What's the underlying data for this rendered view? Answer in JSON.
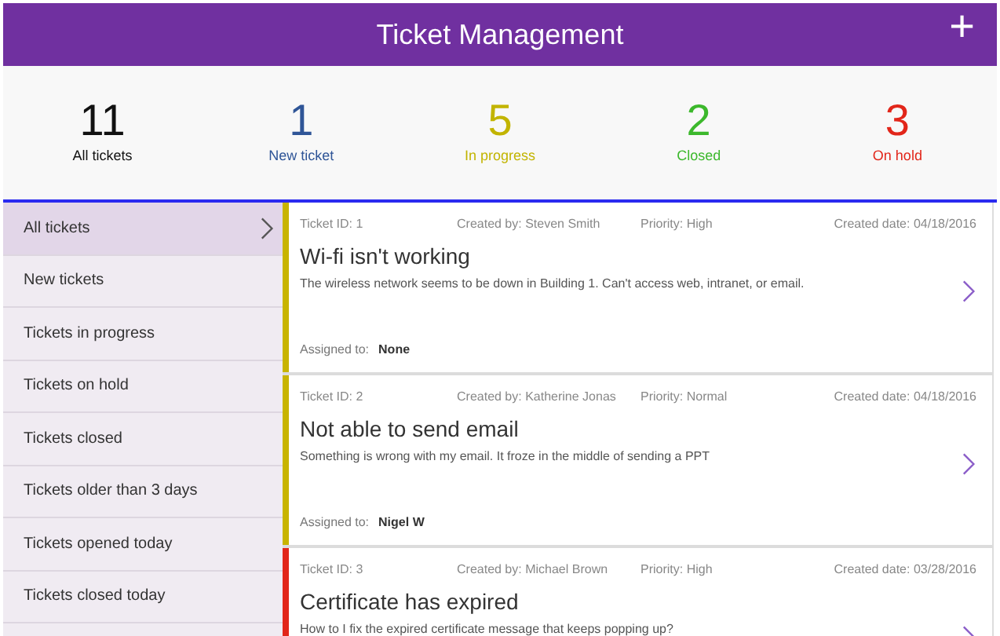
{
  "header": {
    "title": "Ticket Management",
    "add_button": "+"
  },
  "stats": [
    {
      "count": "11",
      "label": "All tickets",
      "color": "#111111"
    },
    {
      "count": "1",
      "label": "New ticket",
      "color": "#2f5597"
    },
    {
      "count": "5",
      "label": "In progress",
      "color": "#c2b400"
    },
    {
      "count": "2",
      "label": "Closed",
      "color": "#3cb82c"
    },
    {
      "count": "3",
      "label": "On hold",
      "color": "#e2261a"
    }
  ],
  "sidebar": {
    "items": [
      {
        "label": "All tickets",
        "selected": true
      },
      {
        "label": "New tickets",
        "selected": false
      },
      {
        "label": "Tickets in progress",
        "selected": false
      },
      {
        "label": "Tickets on hold",
        "selected": false
      },
      {
        "label": "Tickets closed",
        "selected": false
      },
      {
        "label": "Tickets older than 3 days",
        "selected": false
      },
      {
        "label": "Tickets opened today",
        "selected": false
      },
      {
        "label": "Tickets closed today",
        "selected": false
      }
    ]
  },
  "tickets": [
    {
      "id": "Ticket ID: 1",
      "created_by": "Created by: Steven Smith",
      "priority": "Priority: High",
      "created_date": "Created date: 04/18/2016",
      "title": "Wi-fi isn't working",
      "description": "The wireless network seems to be down in Building 1. Can't access web, intranet, or email.",
      "assigned_label": "Assigned to:",
      "assigned_to": "None",
      "color": "#c8b400"
    },
    {
      "id": "Ticket ID: 2",
      "created_by": "Created by: Katherine Jonas",
      "priority": "Priority: Normal",
      "created_date": "Created date: 04/18/2016",
      "title": "Not able to send email",
      "description": "Something is wrong with my email. It froze in the middle of sending a PPT",
      "assigned_label": "Assigned to:",
      "assigned_to": "Nigel W",
      "color": "#c8b400"
    },
    {
      "id": "Ticket ID: 3",
      "created_by": "Created by: Michael Brown",
      "priority": "Priority: High",
      "created_date": "Created date: 03/28/2016",
      "title": "Certificate has expired",
      "description": "How to I fix the expired certificate message that keeps popping up?",
      "color": "#e2261a"
    }
  ]
}
